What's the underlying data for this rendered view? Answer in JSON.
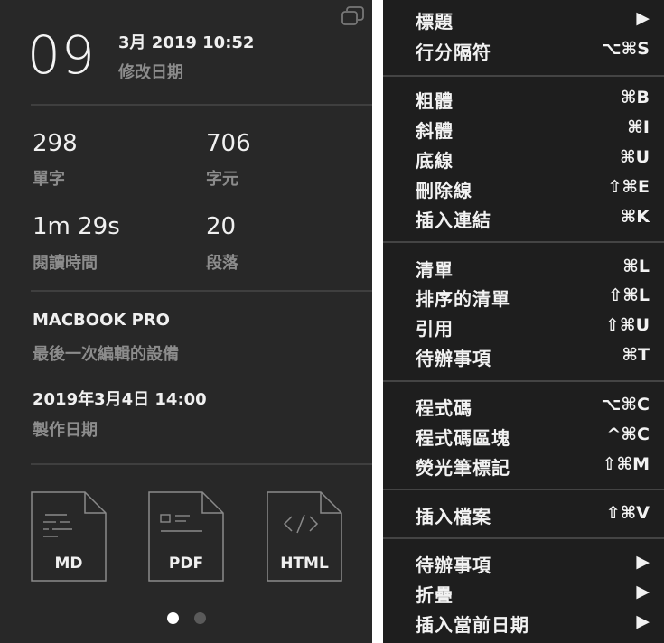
{
  "info": {
    "day": "09",
    "modified_datetime": "3月 2019 10:52",
    "modified_label": "修改日期",
    "stats": [
      {
        "value": "298",
        "label": "單字"
      },
      {
        "value": "706",
        "label": "字元"
      },
      {
        "value": "1m 29s",
        "label": "閱讀時間"
      },
      {
        "value": "20",
        "label": "段落"
      }
    ],
    "device_name": "MACBOOK PRO",
    "device_label": "最後一次編輯的設備",
    "created_datetime": "2019年3月4日 14:00",
    "created_label": "製作日期",
    "exports": [
      {
        "label": "MD",
        "icon": "markdown-file-icon"
      },
      {
        "label": "PDF",
        "icon": "pdf-file-icon"
      },
      {
        "label": "HTML",
        "icon": "html-file-icon"
      }
    ],
    "page_dots": {
      "count": 2,
      "active": 0
    }
  },
  "menu": {
    "items": [
      {
        "label": "標題",
        "shortcut": "▶"
      },
      {
        "label": "行分隔符",
        "shortcut": "⌥⌘S"
      },
      {
        "label": "粗體",
        "shortcut": "⌘B"
      },
      {
        "label": "斜體",
        "shortcut": "⌘I"
      },
      {
        "label": "底線",
        "shortcut": "⌘U"
      },
      {
        "label": "刪除線",
        "shortcut": "⇧⌘E"
      },
      {
        "label": "插入連結",
        "shortcut": "⌘K"
      },
      {
        "label": "清單",
        "shortcut": "⌘L"
      },
      {
        "label": "排序的清單",
        "shortcut": "⇧⌘L"
      },
      {
        "label": "引用",
        "shortcut": "⇧⌘U"
      },
      {
        "label": "待辦事項",
        "shortcut": "⌘T"
      },
      {
        "label": "程式碼",
        "shortcut": "⌥⌘C"
      },
      {
        "label": "程式碼區塊",
        "shortcut": "^⌘C"
      },
      {
        "label": "熒光筆標記",
        "shortcut": "⇧⌘M"
      },
      {
        "label": "插入檔案",
        "shortcut": "⇧⌘V"
      },
      {
        "label": "待辦事項",
        "shortcut": "▶"
      },
      {
        "label": "折疊",
        "shortcut": "▶"
      },
      {
        "label": "插入當前日期",
        "shortcut": "▶"
      }
    ]
  },
  "colors": {
    "panel": "#282828",
    "menu": "#1e1e1e",
    "muted_text": "#8c8c8c",
    "dot_active": "#ffffff",
    "dot_inactive": "#5a5a5a"
  }
}
